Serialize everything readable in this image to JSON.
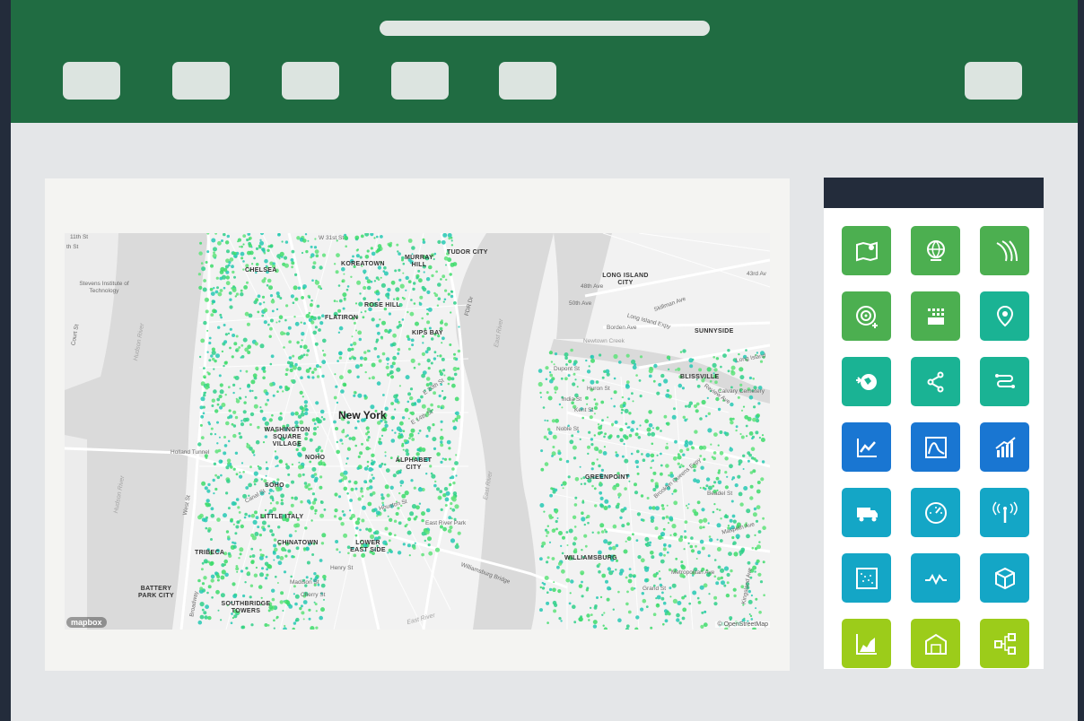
{
  "map": {
    "labels": {
      "koreatown": "KOREATOWN",
      "murray_hill": "MURRAY HILL",
      "tudor_city": "TUDOR CITY",
      "chelsea": "CHELSEA",
      "rose_hill": "ROSE HILL",
      "flatiron": "FLATIRON",
      "kips_bay": "KIPS BAY",
      "long_island_city": "LONG ISLAND CITY",
      "sunnyside": "SUNNYSIDE",
      "blissville": "BLISSVILLE",
      "new_york": "New York",
      "washington_square_village": "WASHINGTON SQUARE VILLAGE",
      "noho": "NOHO",
      "alphabet_city": "ALPHABET CITY",
      "soho": "SOHO",
      "greenpoint": "GREENPOINT",
      "little_italy": "LITTLE ITALY",
      "chinatown": "CHINATOWN",
      "lower_east_side": "LOWER EAST SIDE",
      "tribeca": "TRIBECA",
      "williamsburg": "WILLIAMSBURG",
      "battery_park_city": "BATTERY PARK CITY",
      "southbridge_towers": "SOUTHBRIDGE TOWERS"
    },
    "streets": {
      "s11th": "11th St",
      "sth": "th St",
      "w31st": "W 31st St",
      "stevens": "Stevens Institute of Technology",
      "court": "Court St",
      "hudson1": "Hudson River",
      "hudson2": "Hudson River",
      "eastriver1": "East River",
      "eastriver2": "East River",
      "eastriver3": "East River",
      "av48": "48th Ave",
      "av50": "50th Ave",
      "skillman": "Skillman Ave",
      "borden": "Borden Ave",
      "lie": "Long Island Expy",
      "newtown": "Newtown Creek",
      "holland": "Holland Tunnel",
      "fdr": "FDR Dr",
      "westst": "West St",
      "broadway": "Broadway",
      "canal": "Canal St",
      "houston": "Houston St",
      "e14": "E 14th St",
      "e20": "E 20th St",
      "av43": "43rd Av",
      "calvary": "Calvary Cemetery",
      "review": "Review Ave",
      "lic_blvd": "Long Island",
      "dupont": "Dupont St",
      "huron": "Huron St",
      "india": "India St",
      "kent": "Kent St",
      "noble": "Noble St",
      "beadel": "Beadel St",
      "maspeth": "Maspeth Ave",
      "grand": "Grand St",
      "metropolitan": "Metropolitan Ave",
      "willbridge": "Williamsburg Bridge",
      "eastriverpark": "East River Park",
      "madison": "Madison St",
      "cherry": "Cherry St",
      "henry": "Henry St",
      "bqe": "Brooklyn Queens Expy",
      "kings": "Kingsland Ave"
    },
    "attribution": "© OpenStreetMap",
    "logo": "mapbox"
  },
  "tiles": [
    {
      "icon": "map-location-icon",
      "color": "#4caf50"
    },
    {
      "icon": "globe-icon",
      "color": "#4caf50"
    },
    {
      "icon": "road-icon",
      "color": "#4caf50"
    },
    {
      "icon": "target-add-icon",
      "color": "#4caf50"
    },
    {
      "icon": "dot-grid-icon",
      "color": "#4caf50"
    },
    {
      "icon": "map-pin-icon",
      "color": "#1ab394"
    },
    {
      "icon": "world-pointer-icon",
      "color": "#1ab394"
    },
    {
      "icon": "network-nodes-icon",
      "color": "#1ab394"
    },
    {
      "icon": "route-icon",
      "color": "#1ab394"
    },
    {
      "icon": "line-chart-icon",
      "color": "#1976d2"
    },
    {
      "icon": "area-chart-icon",
      "color": "#1976d2"
    },
    {
      "icon": "bar-trend-icon",
      "color": "#1976d2"
    },
    {
      "icon": "delivery-truck-icon",
      "color": "#14a6c6"
    },
    {
      "icon": "speedometer-icon",
      "color": "#14a6c6"
    },
    {
      "icon": "signal-tower-icon",
      "color": "#14a6c6"
    },
    {
      "icon": "scatter-frame-icon",
      "color": "#14a6c6"
    },
    {
      "icon": "pulse-icon",
      "color": "#14a6c6"
    },
    {
      "icon": "package-icon",
      "color": "#14a6c6"
    },
    {
      "icon": "area-growth-icon",
      "color": "#9ccc1a"
    },
    {
      "icon": "warehouse-icon",
      "color": "#9ccc1a"
    },
    {
      "icon": "flow-diagram-icon",
      "color": "#9ccc1a"
    }
  ],
  "colors": {
    "header": "#206c42",
    "sidebar_header": "#232c3b",
    "background": "#232c3b",
    "dots_primary": "#3ddc6b",
    "dots_secondary": "#26c9b4"
  }
}
